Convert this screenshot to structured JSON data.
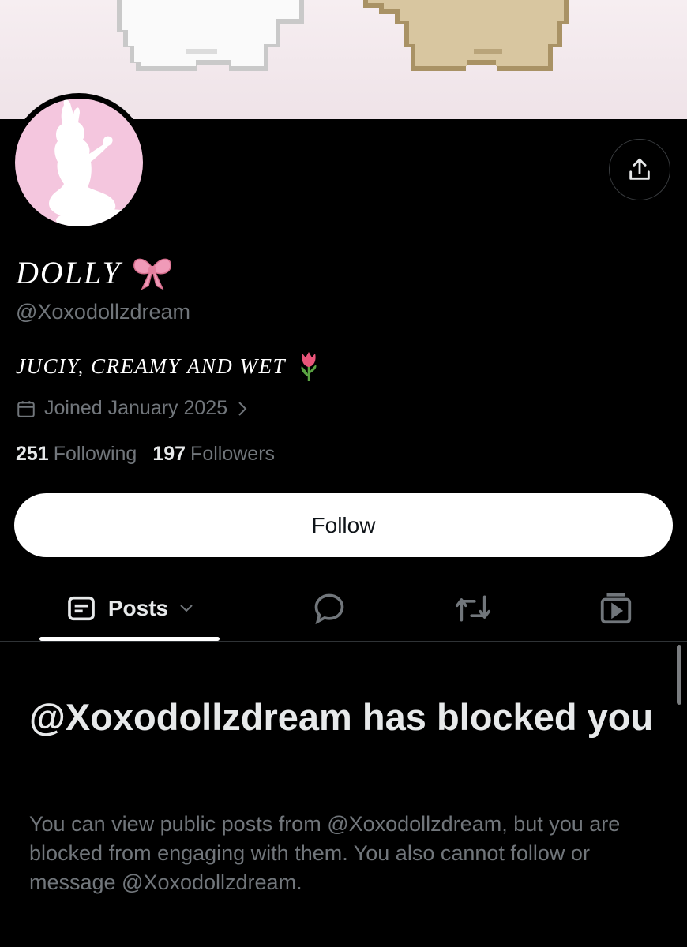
{
  "profile": {
    "display_name": "DOLLY",
    "name_emoji_icon": "ribbon-bow-icon",
    "handle": "@Xoxodollzdream",
    "bio": "JUCIY, CREAMY AND WET",
    "bio_emoji_icon": "tulip-icon",
    "joined": "Joined January 2025",
    "following_count": "251",
    "following_label": "Following",
    "followers_count": "197",
    "followers_label": "Followers"
  },
  "actions": {
    "follow_label": "Follow",
    "share_icon": "share-icon"
  },
  "tabs": {
    "posts_label": "Posts",
    "icons": [
      "posts-icon",
      "replies-icon",
      "reposts-icon",
      "media-icon"
    ]
  },
  "blocked": {
    "title": "@Xoxodollzdream has blocked you",
    "description": "You can view public posts from @Xoxodollzdream, but you are blocked from engaging with them. You also cannot follow or message @Xoxodollzdream."
  },
  "colors": {
    "background": "#000000",
    "text_primary": "#e7e9ea",
    "text_secondary": "#71767b",
    "avatar_pink": "#f4c6de",
    "follow_button_bg": "#ffffff"
  }
}
